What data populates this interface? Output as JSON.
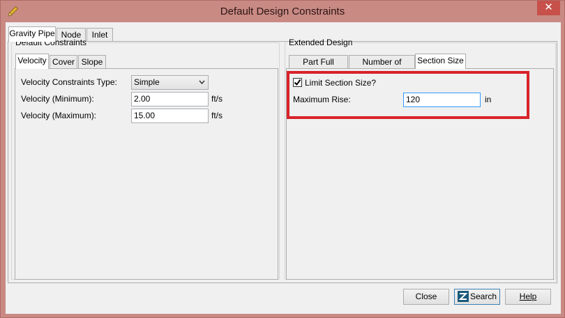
{
  "window": {
    "title": "Default Design Constraints",
    "close_glyph": "✕",
    "app_icon": "pencil-icon"
  },
  "main_tabs": [
    {
      "label": "Gravity Pipe",
      "active": true
    },
    {
      "label": "Node",
      "active": false
    },
    {
      "label": "Inlet",
      "active": false
    }
  ],
  "default_constraints": {
    "legend": "Default Constraints",
    "tabs": [
      {
        "label": "Velocity",
        "active": true
      },
      {
        "label": "Cover",
        "active": false
      },
      {
        "label": "Slope",
        "active": false
      }
    ],
    "velocity_type_label": "Velocity Constraints Type:",
    "velocity_type_value": "Simple",
    "velocity_min_label": "Velocity (Minimum):",
    "velocity_min_value": "2.00",
    "velocity_min_unit": "ft/s",
    "velocity_max_label": "Velocity (Maximum):",
    "velocity_max_value": "15.00",
    "velocity_max_unit": "ft/s"
  },
  "extended_design": {
    "legend": "Extended Design",
    "tabs": [
      {
        "label": "Part Full Design",
        "active": false
      },
      {
        "label": "Number of Barrels",
        "active": false
      },
      {
        "label": "Section Size",
        "active": true
      }
    ],
    "limit_label": "Limit Section Size?",
    "limit_checked": true,
    "max_rise_label": "Maximum Rise:",
    "max_rise_value": "120",
    "max_rise_unit": "in"
  },
  "buttons": {
    "close": "Close",
    "search": "Search",
    "help": "Help"
  },
  "colors": {
    "highlight": "#d8232a",
    "titlebar": "#c98a84"
  }
}
